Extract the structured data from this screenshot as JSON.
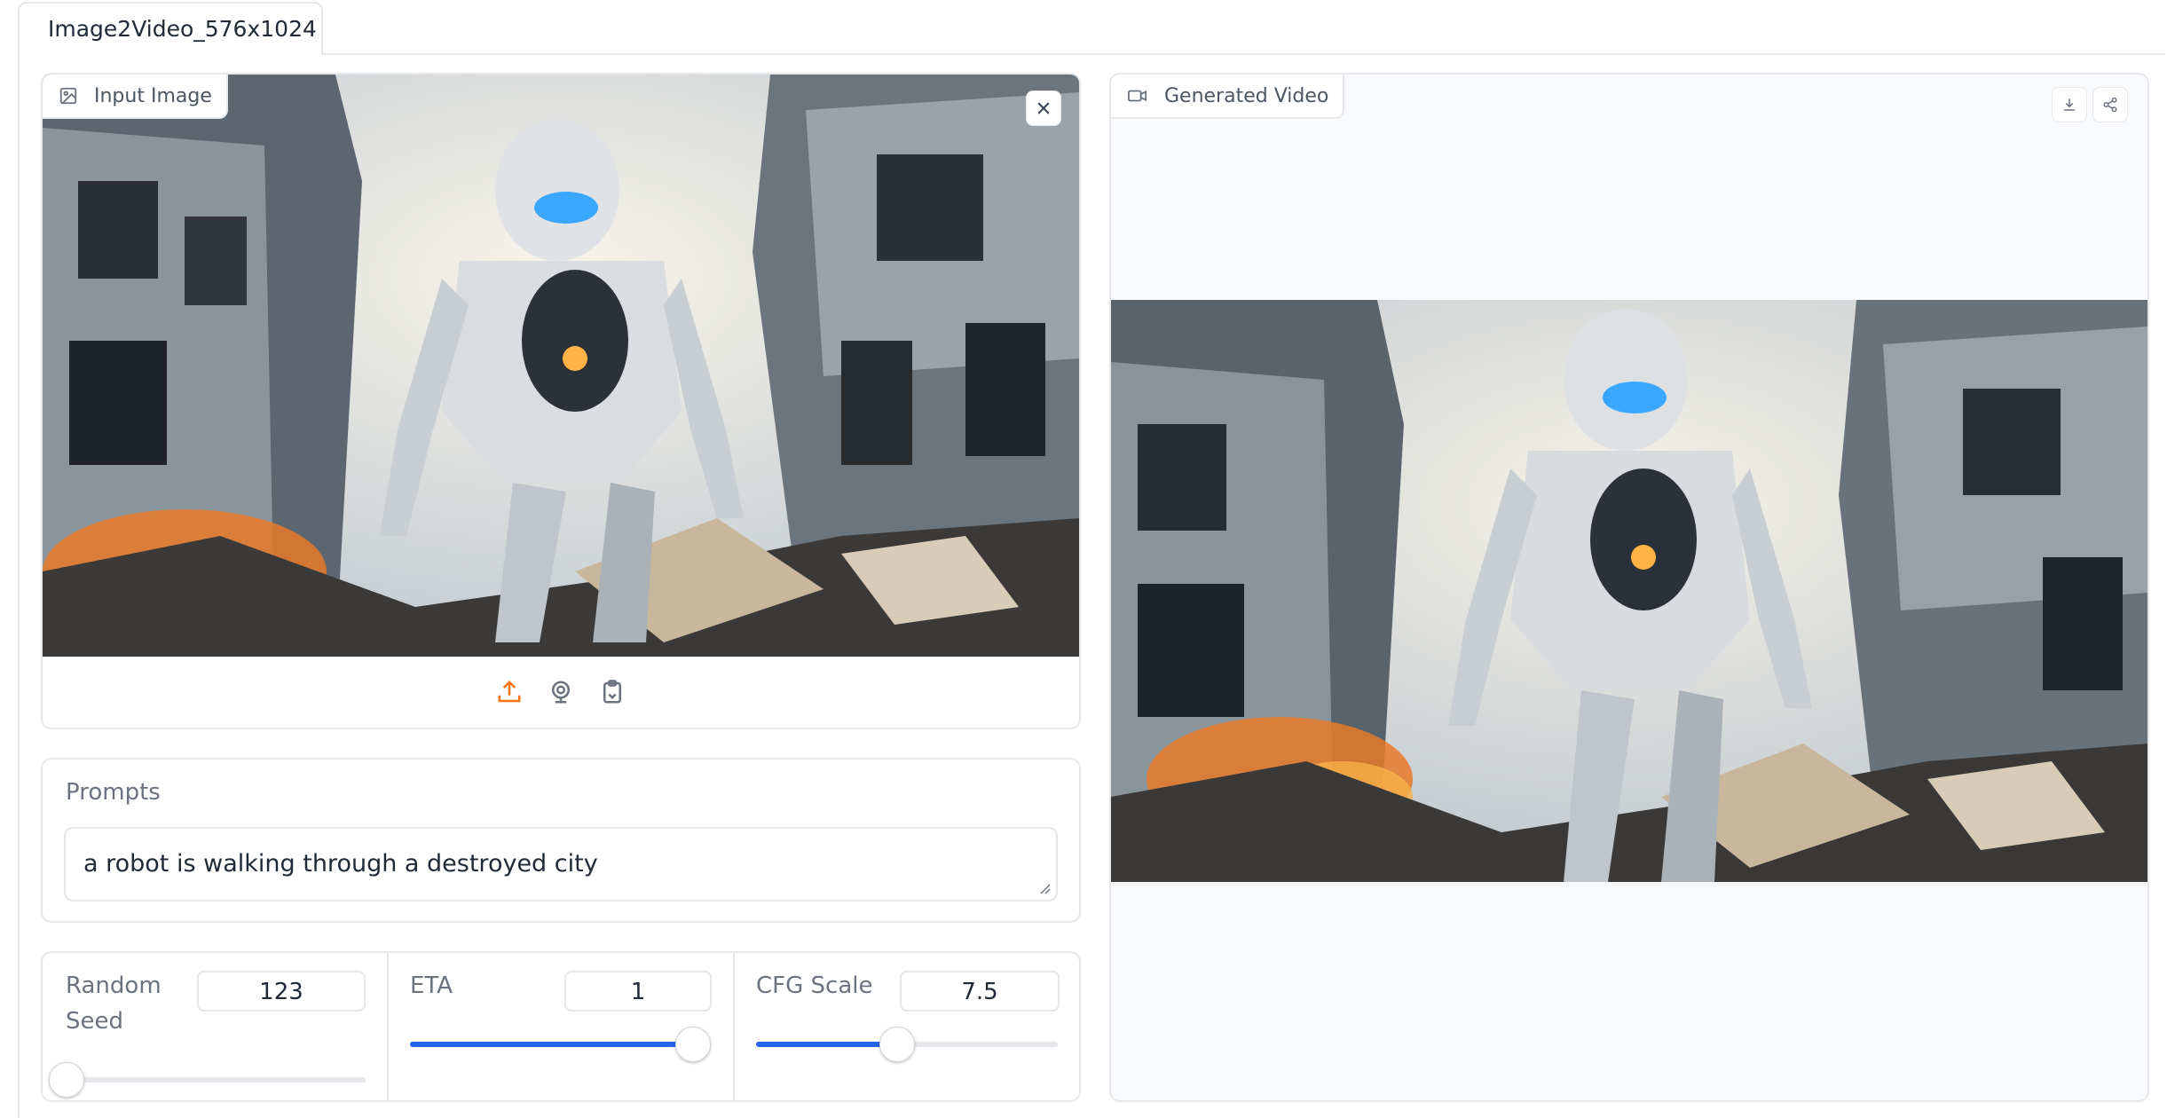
{
  "tab": {
    "label": "Image2Video_576x1024"
  },
  "input_panel": {
    "label": "Input Image",
    "image_alt": "Robot walking through a destroyed city"
  },
  "prompts": {
    "label": "Prompts",
    "value": "a robot is walking through a destroyed city"
  },
  "controls": {
    "seed": {
      "label_line1": "Random",
      "label_line2": "Seed",
      "value": "123",
      "fraction": 0.0
    },
    "eta": {
      "label": "ETA",
      "value": "1",
      "fraction": 1.0
    },
    "cfg": {
      "label": "CFG Scale",
      "value": "7.5",
      "fraction": 0.466
    }
  },
  "output_panel": {
    "label": "Generated Video"
  },
  "icons": {
    "image": "image-icon",
    "close": "close-icon",
    "upload": "upload-icon",
    "webcam": "webcam-icon",
    "clipboard": "clipboard-icon",
    "video": "video-camera-icon",
    "download": "download-icon",
    "share": "share-icon"
  },
  "colors": {
    "accent": "#2563eb",
    "orange": "#f97316",
    "border": "#e5e7eb",
    "output_bg": "#f9fafb"
  }
}
